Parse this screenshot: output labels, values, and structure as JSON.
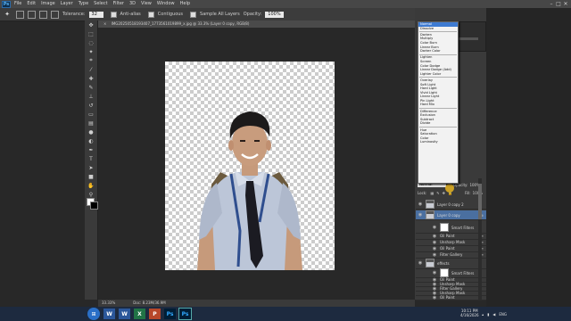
{
  "menubar": {
    "logo": "Ps",
    "items": [
      "File",
      "Edit",
      "Image",
      "Layer",
      "Type",
      "Select",
      "Filter",
      "3D",
      "View",
      "Window",
      "Help"
    ]
  },
  "options_bar": {
    "tolerance_label": "Tolerance:",
    "tolerance_value": "32",
    "anti_alias": "Anti-alias",
    "contiguous": "Contiguous",
    "sample_all": "Sample All Layers",
    "opacity_label": "Opacity:",
    "opacity_value": "100%"
  },
  "document": {
    "tab_title": "IMG20250518193407_1773561019899_x.jpg @ 33.3% (Layer 0 copy, RGB/8)",
    "zoom": "33.33%",
    "doc_size": "Doc: 8.23M/36.9M"
  },
  "blend_menu": {
    "groups": [
      [
        "Normal",
        "Dissolve"
      ],
      [
        "Darken",
        "Multiply",
        "Color Burn",
        "Linear Burn",
        "Darker Color"
      ],
      [
        "Lighten",
        "Screen",
        "Color Dodge",
        "Linear Dodge (Add)",
        "Lighter Color"
      ],
      [
        "Overlay",
        "Soft Light",
        "Hard Light",
        "Vivid Light",
        "Linear Light",
        "Pin Light",
        "Hard Mix"
      ],
      [
        "Difference",
        "Exclusion",
        "Subtract",
        "Divide"
      ],
      [
        "Hue",
        "Saturation",
        "Color",
        "Luminosity"
      ]
    ],
    "selected": "Normal"
  },
  "layers_panel": {
    "blend_mode": "Normal",
    "opacity_label": "Opacity:",
    "opacity_value": "100%",
    "lock_label": "Lock:",
    "fill_label": "Fill:",
    "fill_value": "100%",
    "layers": [
      {
        "name": "Layer 0 copy 2",
        "selected": false
      },
      {
        "name": "Layer 0 copy",
        "selected": true
      }
    ],
    "filters_a": [
      "Smart Filters",
      "Oil Paint",
      "Unsharp Mask",
      "Oil Paint",
      "Filter Gallery"
    ],
    "layer3": "effects",
    "filters_b": [
      "Smart Filters",
      "Oil Paint",
      "Unsharp Mask",
      "Filter Gallery",
      "Unsharp Mask",
      "Oil Paint"
    ]
  },
  "taskbar": {
    "apps": [
      "W",
      "W",
      "X",
      "P",
      "Ps",
      "Ps"
    ],
    "tray": [
      "ENG"
    ],
    "time": "10:11 PM",
    "date": "4/16/2026"
  },
  "colors": {
    "ps_bg": "#282828",
    "panel": "#3a3a3a",
    "selected_layer": "#4a6fa0",
    "menu_highlight": "#3d7ad1",
    "taskbar": "#1d2a3f"
  }
}
